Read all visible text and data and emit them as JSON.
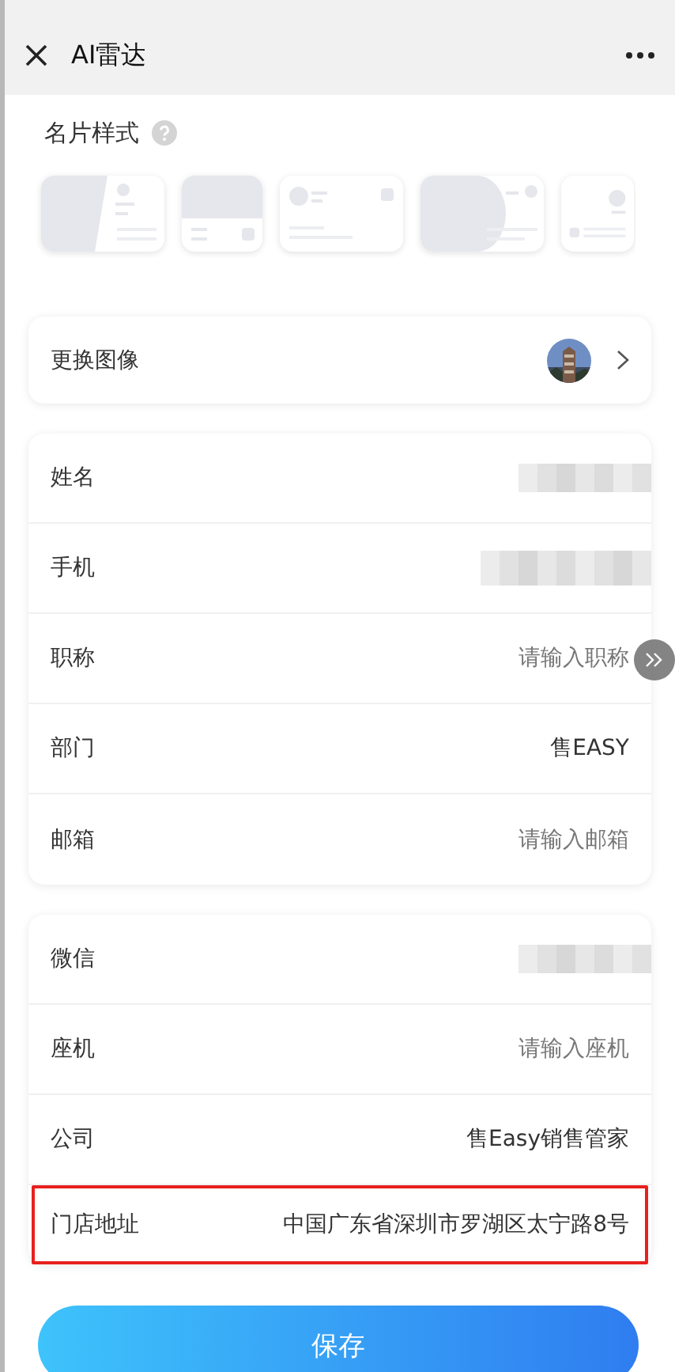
{
  "header": {
    "title": "AI雷达"
  },
  "card_style": {
    "label": "名片样式",
    "templates": [
      {
        "kind": "slant"
      },
      {
        "kind": "band"
      },
      {
        "kind": "dot-left"
      },
      {
        "kind": "half-round"
      },
      {
        "kind": "dot-right"
      }
    ]
  },
  "avatar_row": {
    "label": "更换图像"
  },
  "sections": [
    {
      "fields": [
        {
          "label": "姓名",
          "kind": "blurred",
          "highlighted": false
        },
        {
          "label": "手机",
          "kind": "blurred",
          "highlighted": false
        },
        {
          "label": "职称",
          "kind": "placeholder",
          "placeholder": "请输入职称",
          "highlighted": false
        },
        {
          "label": "部门",
          "kind": "value",
          "value": "售EASY",
          "highlighted": false
        },
        {
          "label": "邮箱",
          "kind": "placeholder",
          "placeholder": "请输入邮箱",
          "highlighted": false
        }
      ]
    },
    {
      "fields": [
        {
          "label": "微信",
          "kind": "blurred",
          "highlighted": false
        },
        {
          "label": "座机",
          "kind": "placeholder",
          "placeholder": "请输入座机",
          "highlighted": false
        },
        {
          "label": "公司",
          "kind": "value",
          "value": "售Easy销售管家",
          "highlighted": false
        },
        {
          "label": "门店地址",
          "kind": "value",
          "value": "中国广东省深圳市罗湖区太宁路8号",
          "highlighted": true
        }
      ]
    }
  ],
  "save_button": {
    "label": "保存"
  }
}
